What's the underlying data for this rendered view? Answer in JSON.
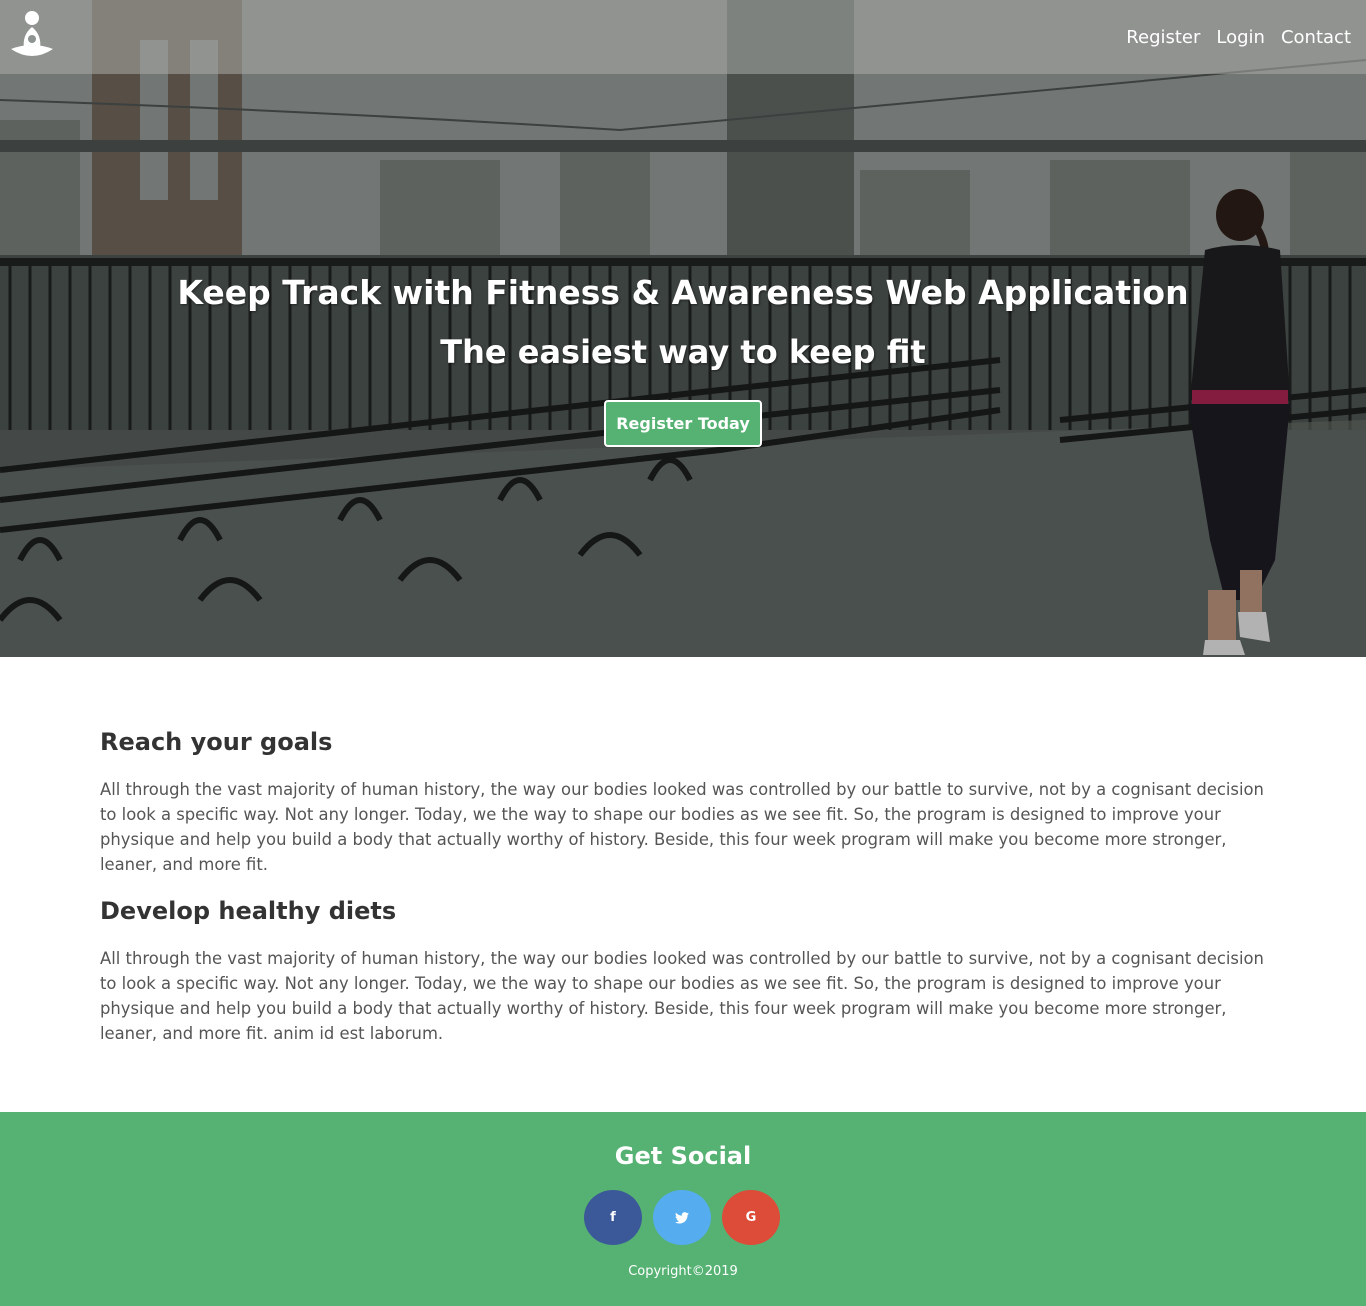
{
  "nav": {
    "links": [
      "Register",
      "Login",
      "Contact"
    ]
  },
  "hero": {
    "title": "Keep Track with Fitness & Awareness Web Application",
    "subtitle": "The easiest way to keep fit",
    "cta_label": "Register Today"
  },
  "sections": [
    {
      "heading": "Reach your goals",
      "text": "All through the vast majority of human history, the way our bodies looked was controlled by our battle to survive, not by a cognisant decision to look a specific way. Not any longer. Today, we the way to shape our bodies as we see fit. So, the program is designed to improve your physique and help you build a body that actually worthy of history. Beside, this four week program will make you become more stronger, leaner, and more fit."
    },
    {
      "heading": "Develop healthy diets",
      "text": "All through the vast majority of human history, the way our bodies looked was controlled by our battle to survive, not by a cognisant decision to look a specific way. Not any longer. Today, we the way to shape our bodies as we see fit. So, the program is designed to improve your physique and help you build a body that actually worthy of history. Beside, this four week program will make you become more stronger, leaner, and more fit. anim id est laborum."
    }
  ],
  "footer": {
    "title": "Get Social",
    "social": [
      {
        "icon": "facebook-icon",
        "glyph": "f",
        "color": "#3b5998"
      },
      {
        "icon": "twitter-icon",
        "glyph": "🐦",
        "color": "#55acee"
      },
      {
        "icon": "google-icon",
        "glyph": "G",
        "color": "#dd4b39"
      }
    ],
    "copyright": "Copyright©2019"
  },
  "colors": {
    "accent": "#56b273",
    "text_dark": "#333333",
    "text_body": "#555555"
  }
}
